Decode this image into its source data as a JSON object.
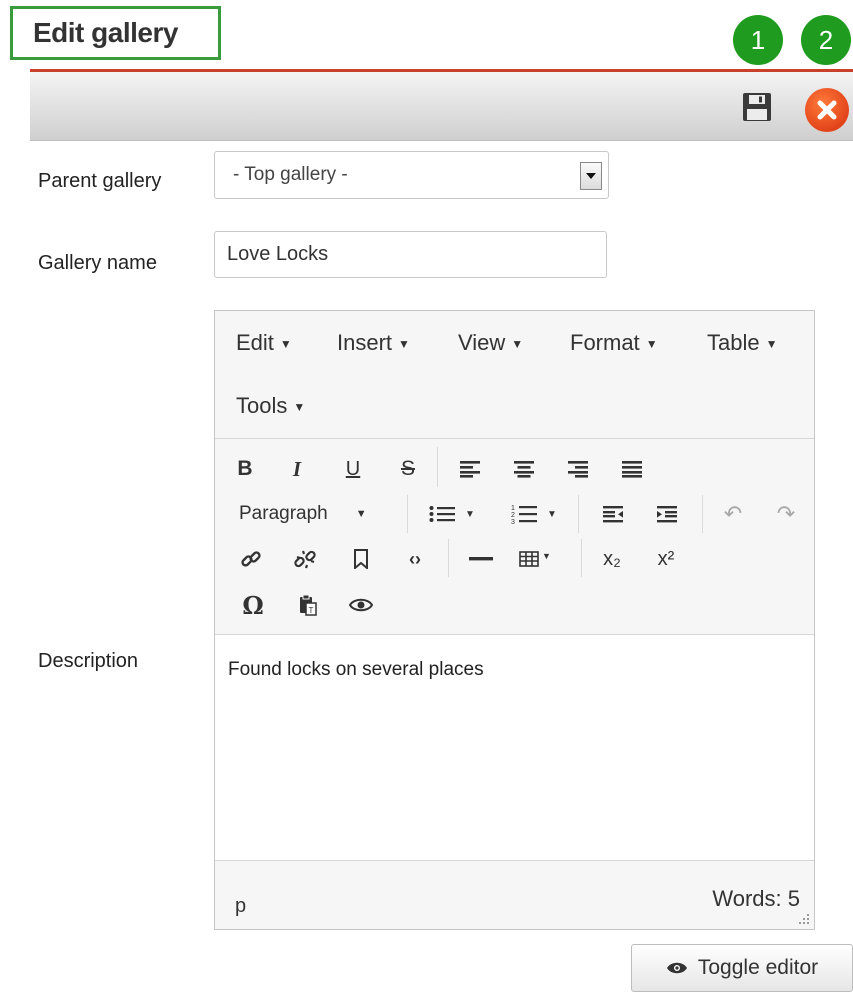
{
  "header": {
    "title": "Edit gallery",
    "badges": [
      "1",
      "2"
    ]
  },
  "toolbar": {
    "save_icon": "save-icon",
    "close_icon": "close-icon"
  },
  "form": {
    "parent_gallery_label": "Parent gallery",
    "parent_gallery_value": "- Top gallery -",
    "gallery_name_label": "Gallery name",
    "gallery_name_value": "Love Locks",
    "description_label": "Description"
  },
  "editor": {
    "menus": [
      "Edit",
      "Insert",
      "View",
      "Format",
      "Table",
      "Tools"
    ],
    "block_format": "Paragraph",
    "content": "Found locks on several places",
    "status_path": "p",
    "word_count": "Words: 5",
    "subscript_label": "x₂",
    "superscript_label": "x²",
    "bold_label": "B",
    "italic_label": "I",
    "underline_label": "U",
    "strike_label": "S",
    "omega_label": "Ω"
  },
  "toggle_editor_label": "Toggle editor",
  "colors": {
    "accent_green": "#1f9b1f",
    "accent_red": "#c9412b",
    "close_orange": "#e2441a"
  }
}
